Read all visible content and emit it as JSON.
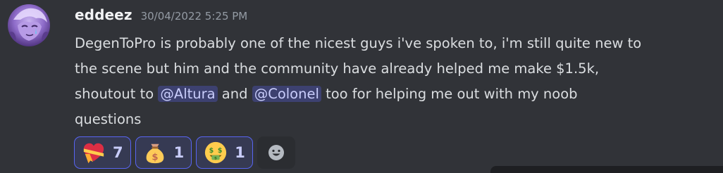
{
  "message": {
    "username": "eddeez",
    "timestamp": "30/04/2022 5:25 PM",
    "lines": [
      "DegenToPro is probably one of the nicest guys i've spoken to, i'm still quite new to",
      "the scene but him and the community have already helped me make $1.5k,"
    ],
    "line3": {
      "prefix": "shoutout to ",
      "mention1": "@Altura",
      "middle": " and ",
      "mention2": "@Colonel",
      "suffix": " too for helping me out with my noob"
    },
    "line4": "questions"
  },
  "reactions": [
    {
      "icon": "heart-ribbon-icon",
      "count": "7"
    },
    {
      "icon": "money-bag-icon",
      "count": "1"
    },
    {
      "icon": "money-mouth-face-icon",
      "count": "1"
    }
  ],
  "add_reaction_icon": "add-reaction-smiley-icon",
  "colors": {
    "background": "#313338",
    "mention_bg": "rgba(88,101,242,0.3)",
    "mention_text": "#c9cdfb",
    "reaction_border": "#5865f2",
    "timestamp": "#949ba4"
  }
}
